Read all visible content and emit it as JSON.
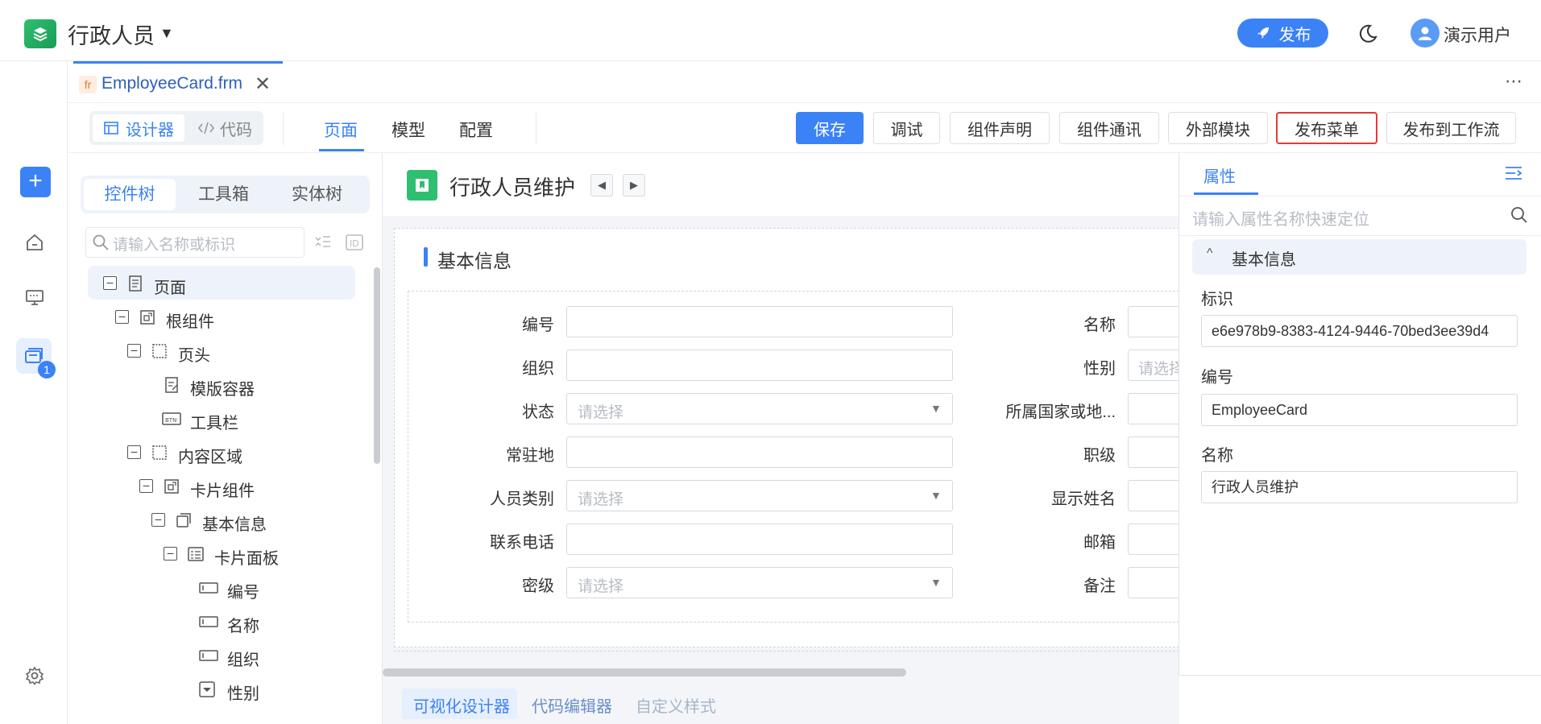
{
  "header": {
    "app_title": "行政人员",
    "app_title_caret": "▼",
    "publish_label": "发布",
    "user_name": "演示用户"
  },
  "rail": {
    "badge": "1",
    "add_label": "+"
  },
  "file_tab": {
    "badge": "fr",
    "name": "EmployeeCard.frm",
    "close": "✕",
    "more": "⋯"
  },
  "toolbar": {
    "mode_designer": "设计器",
    "mode_code": "代码",
    "view_tabs": [
      "页面",
      "模型",
      "配置"
    ],
    "buttons": [
      "保存",
      "调试",
      "组件声明",
      "组件通讯",
      "外部模块",
      "发布菜单",
      "发布到工作流"
    ]
  },
  "left_panel": {
    "tabs": [
      "控件树",
      "工具箱",
      "实体树"
    ],
    "search_placeholder": "请输入名称或标识",
    "tree": [
      "页面",
      "根组件",
      "页头",
      "模版容器",
      "工具栏",
      "内容区域",
      "卡片组件",
      "基本信息",
      "卡片面板",
      "编号",
      "名称",
      "组织",
      "性别"
    ]
  },
  "canvas": {
    "page_title": "行政人员维护",
    "prev": "◀",
    "next": "▶",
    "section_title": "基本信息",
    "left_fields": [
      {
        "label": "编号",
        "placeholder": ""
      },
      {
        "label": "组织",
        "placeholder": ""
      },
      {
        "label": "状态",
        "placeholder": "请选择"
      },
      {
        "label": "常驻地",
        "placeholder": ""
      },
      {
        "label": "人员类别",
        "placeholder": "请选择"
      },
      {
        "label": "联系电话",
        "placeholder": ""
      },
      {
        "label": "密级",
        "placeholder": "请选择"
      }
    ],
    "right_fields": [
      {
        "label": "名称",
        "placeholder": ""
      },
      {
        "label": "性别",
        "placeholder": "请选择"
      },
      {
        "label": "所属国家或地...",
        "placeholder": ""
      },
      {
        "label": "职级",
        "placeholder": ""
      },
      {
        "label": "显示姓名",
        "placeholder": ""
      },
      {
        "label": "邮箱",
        "placeholder": ""
      },
      {
        "label": "备注",
        "placeholder": ""
      }
    ],
    "bottom_tabs": [
      "可视化设计器",
      "代码编辑器",
      "自定义样式"
    ]
  },
  "right_panel": {
    "tab": "属性",
    "search_placeholder": "请输入属性名称快速定位",
    "group_title": "基本信息",
    "group_caret": "^",
    "props": [
      {
        "label": "标识",
        "value": "e6e978b9-8383-4124-9446-70bed3ee39d4"
      },
      {
        "label": "编号",
        "value": "EmployeeCard"
      },
      {
        "label": "名称",
        "value": "行政人员维护"
      }
    ]
  },
  "colors": {
    "accent": "#3b82f6",
    "brand_green": "#2fbf71",
    "highlight_border": "#e53935"
  }
}
